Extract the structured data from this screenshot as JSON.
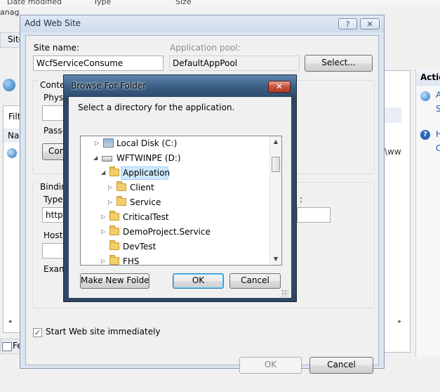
{
  "background": {
    "col_date": "Date modified",
    "col_type": "Type",
    "col_size": "Size",
    "left_top": "anage",
    "crumb": "Site",
    "filter_label": "Filt",
    "name_col": "Na",
    "actions_title": "Actio",
    "action_a": "A",
    "action_s": "S",
    "action_h": "H",
    "action_c": "C",
    "path_tail": "\\ww",
    "bottom_tab": "Fe"
  },
  "add_web_site": {
    "title": "Add Web Site",
    "help_btn": "?",
    "close_btn": "✕",
    "site_name_label": "Site name:",
    "site_name_value": "WcfServiceConsume",
    "app_pool_label": "Application pool:",
    "app_pool_value": "DefaultAppPool",
    "select_button": "Select...",
    "content_label": "Conte",
    "physical_label": "Physi",
    "pass_label": "Pass-",
    "connect_button": "Con",
    "binding_label": "Binding",
    "type_label": "Type",
    "type_value": "http",
    "host_label": "Host",
    "example_label": "Exam",
    "port_colon": ":",
    "start_checkbox_label": "Start Web site immediately",
    "start_checked": true,
    "ok_button": "OK",
    "cancel_button": "Cancel"
  },
  "browse": {
    "title": "Browse For Folder",
    "close_btn": "✕",
    "instruction": "Select a directory for the application.",
    "tree": [
      {
        "label": "Local Disk (C:)",
        "icon": "hard-disk-icon",
        "expanded": false,
        "selected": false
      },
      {
        "label": "WFTWINPE (D:)",
        "icon": "drive-icon",
        "expanded": true,
        "selected": false
      },
      {
        "label": "Application",
        "icon": "folder-icon",
        "expanded": true,
        "selected": true
      },
      {
        "label": "Client",
        "icon": "folder-icon",
        "expanded": false,
        "selected": false
      },
      {
        "label": "Service",
        "icon": "folder-icon",
        "expanded": false,
        "selected": false
      },
      {
        "label": "CriticalTest",
        "icon": "folder-icon",
        "expanded": false,
        "selected": false
      },
      {
        "label": "DemoProject.Service",
        "icon": "folder-icon",
        "expanded": false,
        "selected": false
      },
      {
        "label": "DevTest",
        "icon": "folder-icon",
        "expanded": null,
        "selected": false
      },
      {
        "label": "FHS",
        "icon": "folder-icon",
        "expanded": false,
        "selected": false
      }
    ],
    "make_new_folder_button": "Make New Folder",
    "ok_button": "OK",
    "cancel_button": "Cancel"
  },
  "colors": {
    "dialog_frame": "#dbe5f1",
    "browse_frame": "#2f4763",
    "selection": "#cde8ff",
    "close_red": "#c9513b"
  }
}
